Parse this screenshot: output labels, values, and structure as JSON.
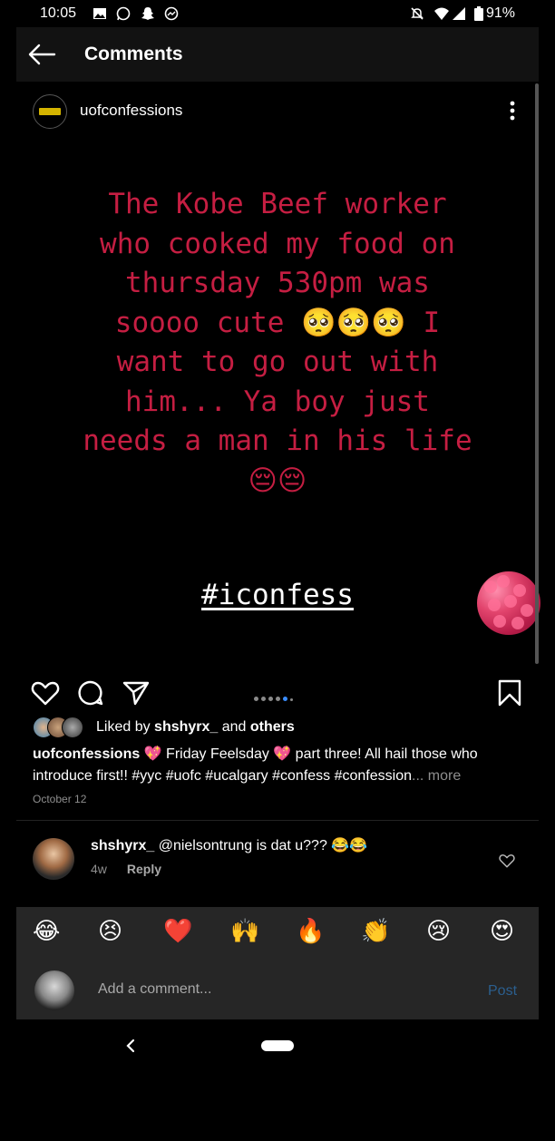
{
  "status_bar": {
    "time": "10:05",
    "battery": "91%",
    "left_icons": [
      "gallery-icon",
      "whatsapp-icon",
      "snapchat-icon",
      "messenger-icon"
    ],
    "right_icons": [
      "mute-icon",
      "wifi-icon",
      "signal-icon",
      "battery-icon"
    ]
  },
  "top_bar": {
    "title": "Comments"
  },
  "post": {
    "username": "uofconfessions",
    "image": {
      "text_lines": [
        "The Kobe Beef worker",
        "who cooked my food on",
        "thursday 530pm was",
        "soooo cute 🥺🥺🥺 I",
        "want to go out with",
        "him... Ya boy just",
        "needs a man in his life",
        "😔😔"
      ],
      "hashtag": "#iconfess",
      "text_color": "#c51e42"
    },
    "carousel": {
      "count": 6,
      "active_index": 4
    },
    "likes": {
      "prefix": "Liked by ",
      "user": "shshyrx_",
      "middle": " and ",
      "suffix": "others"
    },
    "caption": {
      "user": "uofconfessions",
      "text": " 💖 Friday Feelsday 💖 part three! All hail those who introduce first!! #yyc #uofc #ucalgary #confess #confession",
      "more": "... more"
    },
    "date": "October 12"
  },
  "comments": [
    {
      "user": "shshyrx_",
      "text": " @nielsontrung is dat u??? 😂😂",
      "age": "4w",
      "reply": "Reply"
    }
  ],
  "emoji_bar": [
    "😂",
    "😣",
    "❤️",
    "🙌",
    "🔥",
    "👏",
    "😢",
    "😍"
  ],
  "composer": {
    "placeholder": "Add a comment...",
    "post_label": "Post"
  },
  "colors": {
    "accent": "#3a8dff",
    "post_disabled": "#2b5f8f"
  }
}
